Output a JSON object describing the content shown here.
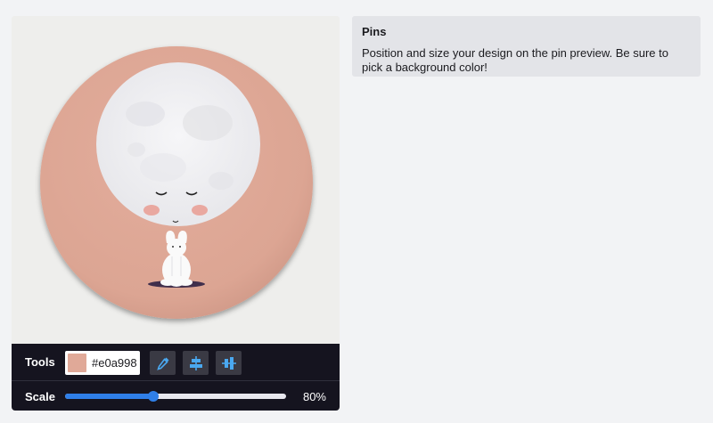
{
  "editor": {
    "design": {
      "background_color": "#e0a998",
      "description": "pin design with moon and white bunny"
    },
    "tools": {
      "label": "Tools",
      "color_value": "#e0a998",
      "eyedropper_icon": "eyedropper-icon",
      "align_horizontal_icon": "align-center-horizontal-icon",
      "align_vertical_icon": "align-center-vertical-icon"
    },
    "scale": {
      "label": "Scale",
      "value": 0.4,
      "display": "80%"
    }
  },
  "info": {
    "title": "Pins",
    "text": "Position and size your design on the pin preview. Be sure to pick a background color!"
  },
  "colors": {
    "accent": "#2f7fe8",
    "toolbar": "#15141f",
    "icon_blue": "#4aa8f0"
  }
}
